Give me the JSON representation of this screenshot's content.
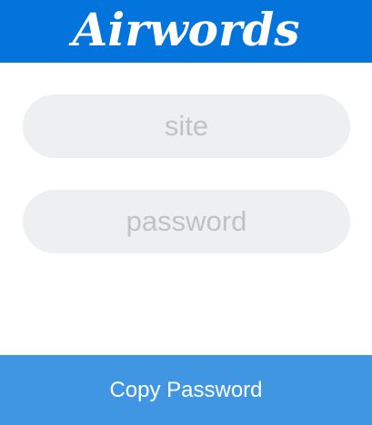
{
  "header": {
    "logo_text": "Airwords",
    "background_color": "#0474dd"
  },
  "form": {
    "site": {
      "value": "",
      "placeholder": "site"
    },
    "password": {
      "value": "",
      "placeholder": "password"
    }
  },
  "actions": {
    "copy_label": "Copy Password",
    "button_color": "#4096e3"
  }
}
